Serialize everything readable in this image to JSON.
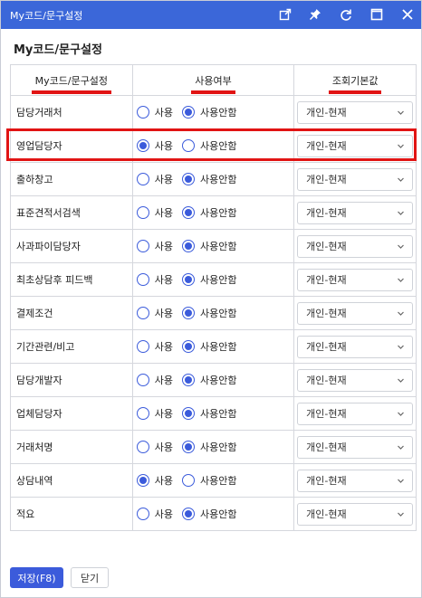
{
  "window": {
    "title": "My코드/문구설정",
    "heading": "My코드/문구설정"
  },
  "titlebar_icons": [
    "open-external-icon",
    "pin-icon",
    "refresh-icon",
    "maximize-icon",
    "close-icon"
  ],
  "columns": {
    "code": "My코드/문구설정",
    "use": "사용여부",
    "default": "조회기본값"
  },
  "radio_labels": {
    "use": "사용",
    "unuse": "사용안함"
  },
  "rows": [
    {
      "name": "담당거래처",
      "selected": "unuse",
      "default_value": "개인-현재"
    },
    {
      "name": "영업담당자",
      "selected": "use",
      "default_value": "개인-현재"
    },
    {
      "name": "출하창고",
      "selected": "unuse",
      "default_value": "개인-현재"
    },
    {
      "name": "표준견적서검색",
      "selected": "unuse",
      "default_value": "개인-현재"
    },
    {
      "name": "사과파이담당자",
      "selected": "unuse",
      "default_value": "개인-현재"
    },
    {
      "name": "최초상담후 피드백",
      "selected": "unuse",
      "default_value": "개인-현재"
    },
    {
      "name": "결제조건",
      "selected": "unuse",
      "default_value": "개인-현재"
    },
    {
      "name": "기간관련/비고",
      "selected": "unuse",
      "default_value": "개인-현재"
    },
    {
      "name": "담당개발자",
      "selected": "unuse",
      "default_value": "개인-현재"
    },
    {
      "name": "업체담당자",
      "selected": "unuse",
      "default_value": "개인-현재"
    },
    {
      "name": "거래처명",
      "selected": "unuse",
      "default_value": "개인-현재"
    },
    {
      "name": "상담내역",
      "selected": "use",
      "default_value": "개인-현재"
    },
    {
      "name": "적요",
      "selected": "unuse",
      "default_value": "개인-현재"
    }
  ],
  "footer": {
    "save_label": "저장(F8)",
    "close_label": "닫기"
  },
  "colors": {
    "titlebar": "#3b67d9",
    "accent": "#3b5bdb",
    "highlight": "#e11414"
  }
}
